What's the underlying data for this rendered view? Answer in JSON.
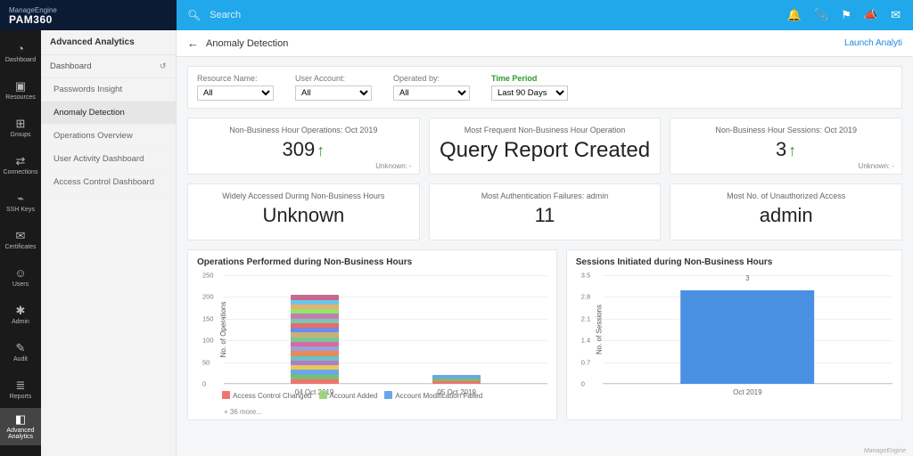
{
  "brand": {
    "vendor": "ManageEngine",
    "product": "PAM360"
  },
  "search": {
    "placeholder": "Search"
  },
  "rail": [
    {
      "name": "dashboard",
      "label": "Dashboard",
      "glyph": "◔"
    },
    {
      "name": "resources",
      "label": "Resources",
      "glyph": "▣"
    },
    {
      "name": "groups",
      "label": "Groups",
      "glyph": "⊞"
    },
    {
      "name": "connections",
      "label": "Connections",
      "glyph": "⇄"
    },
    {
      "name": "sshkeys",
      "label": "SSH Keys",
      "glyph": "⌁"
    },
    {
      "name": "certificates",
      "label": "Certificates",
      "glyph": "✉"
    },
    {
      "name": "users",
      "label": "Users",
      "glyph": "☺"
    },
    {
      "name": "admin",
      "label": "Admin",
      "glyph": "✱"
    },
    {
      "name": "audit",
      "label": "Audit",
      "glyph": "✎"
    },
    {
      "name": "reports",
      "label": "Reports",
      "glyph": "≣"
    },
    {
      "name": "advanced-analytics",
      "label": "Advanced Analytics",
      "glyph": "◧",
      "active": true
    }
  ],
  "leftnav": {
    "header": "Advanced Analytics",
    "group": "Dashboard",
    "items": [
      {
        "label": "Passwords Insight"
      },
      {
        "label": "Anomaly Detection",
        "active": true
      },
      {
        "label": "Operations Overview"
      },
      {
        "label": "User Activity Dashboard"
      },
      {
        "label": "Access Control Dashboard"
      }
    ]
  },
  "page": {
    "title": "Anomaly Detection",
    "launch": "Launch Analyti"
  },
  "filters": {
    "resource": {
      "label": "Resource Name:",
      "value": "All"
    },
    "user": {
      "label": "User Account:",
      "value": "All"
    },
    "operator": {
      "label": "Operated by:",
      "value": "All"
    },
    "period": {
      "label": "Time Period",
      "value": "Last 90 Days"
    }
  },
  "kpi_top": [
    {
      "title": "Non-Business Hour Operations: Oct 2019",
      "value": "309",
      "arrow": true,
      "footer": "Unknown: -"
    },
    {
      "title": "Most Frequent Non-Business Hour Operation",
      "value": "Query Report Created"
    },
    {
      "title": "Non-Business Hour Sessions: Oct 2019",
      "value": "3",
      "arrow": true,
      "footer": "Unknown: -"
    }
  ],
  "kpi_bottom": [
    {
      "title": "Widely Accessed During Non-Business Hours",
      "value": "Unknown"
    },
    {
      "title": "Most Authentication Failures: admin",
      "value": "11"
    },
    {
      "title": "Most No. of Unauthorized Access",
      "value": "admin"
    }
  ],
  "chart_data": [
    {
      "type": "bar",
      "title": "Operations Performed during Non-Business Hours",
      "ylabel": "No. of Operations",
      "ylim": [
        0,
        250
      ],
      "yticks": [
        0,
        50,
        100,
        150,
        200,
        250
      ],
      "categories": [
        "04 Oct 2019",
        "05 Oct 2019"
      ],
      "stacked": true,
      "series_note": "+ 36 more...",
      "legend": [
        {
          "name": "Access Control Changed",
          "color": "#f07373"
        },
        {
          "name": "Account Added",
          "color": "#9cd67c"
        },
        {
          "name": "Account Modification Failed",
          "color": "#6aa7e8"
        }
      ],
      "totals": [
        205,
        20
      ],
      "stack_colors": [
        "#f07373",
        "#7bbf6a",
        "#6aa7e8",
        "#e8c85a",
        "#b07cc6",
        "#6ac4c4",
        "#e88a5a",
        "#9aa0d6",
        "#d66aa7",
        "#7cc690",
        "#c6b07c",
        "#6a8de8",
        "#e86a6a",
        "#7cc6b0",
        "#c67cb0",
        "#8de86a",
        "#e8b06a",
        "#6ac6e8",
        "#c66a8d",
        "#a0d69a"
      ]
    },
    {
      "type": "bar",
      "title": "Sessions Initiated during Non-Business Hours",
      "ylabel": "No. of Sessions",
      "ylim": [
        0,
        3.5
      ],
      "yticks": [
        0,
        0.7,
        1.4,
        2.1,
        2.8,
        3.5
      ],
      "categories": [
        "Oct 2019"
      ],
      "values": [
        3
      ],
      "bar_color": "#4a90e2"
    }
  ],
  "footer": "ManageEngine"
}
